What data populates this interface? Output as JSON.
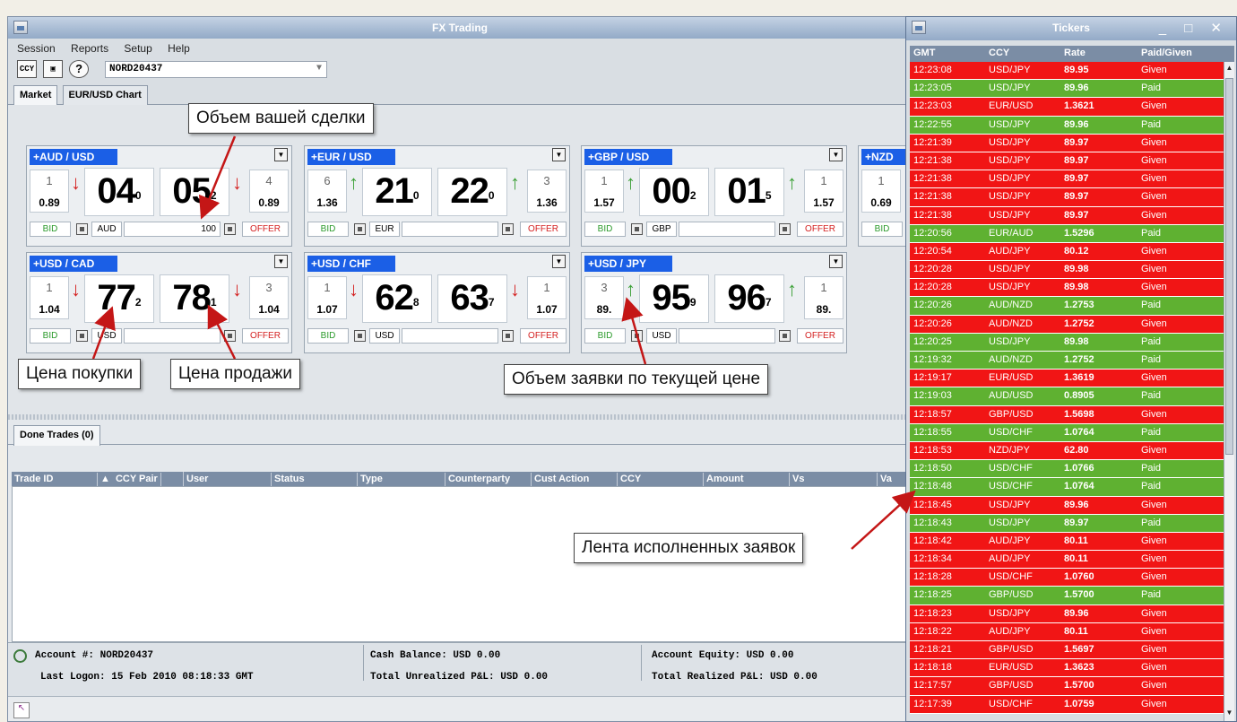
{
  "main_window": {
    "title": "FX Trading",
    "menu": [
      "Session",
      "Reports",
      "Setup",
      "Help"
    ],
    "toolbar": {
      "ccy_icon_text": "CCY",
      "help_icon_text": "?",
      "account_value": "NORD20437"
    },
    "tabs": [
      "Market",
      "EUR/USD Chart"
    ]
  },
  "cards": [
    {
      "pair": "AUD / USD",
      "left_vol": "1",
      "left_rate": "0.89",
      "bid_big": "04",
      "bid_small": "0",
      "ask_big": "05",
      "ask_small": "2",
      "right_vol": "4",
      "right_rate": "0.89",
      "bid_dir": "down",
      "ask_dir": "down",
      "ccy": "AUD",
      "amount": "100"
    },
    {
      "pair": "EUR / USD",
      "left_vol": "6",
      "left_rate": "1.36",
      "bid_big": "21",
      "bid_small": "0",
      "ask_big": "22",
      "ask_small": "0",
      "right_vol": "3",
      "right_rate": "1.36",
      "bid_dir": "up",
      "ask_dir": "up",
      "ccy": "EUR",
      "amount": ""
    },
    {
      "pair": "GBP / USD",
      "left_vol": "1",
      "left_rate": "1.57",
      "bid_big": "00",
      "bid_small": "2",
      "ask_big": "01",
      "ask_small": "5",
      "right_vol": "1",
      "right_rate": "1.57",
      "bid_dir": "up",
      "ask_dir": "up",
      "ccy": "GBP",
      "amount": ""
    },
    {
      "pair": "USD / CAD",
      "left_vol": "1",
      "left_rate": "1.04",
      "bid_big": "77",
      "bid_small": "2",
      "ask_big": "78",
      "ask_small": "1",
      "right_vol": "3",
      "right_rate": "1.04",
      "bid_dir": "down",
      "ask_dir": "down",
      "ccy": "USD",
      "amount": ""
    },
    {
      "pair": "USD / CHF",
      "left_vol": "1",
      "left_rate": "1.07",
      "bid_big": "62",
      "bid_small": "8",
      "ask_big": "63",
      "ask_small": "7",
      "right_vol": "1",
      "right_rate": "1.07",
      "bid_dir": "down",
      "ask_dir": "down",
      "ccy": "USD",
      "amount": ""
    },
    {
      "pair": "USD / JPY",
      "left_vol": "3",
      "left_rate": "89.",
      "bid_big": "95",
      "bid_small": "9",
      "ask_big": "96",
      "ask_small": "7",
      "right_vol": "1",
      "right_rate": "89.",
      "bid_dir": "up",
      "ask_dir": "up",
      "ccy": "USD",
      "amount": ""
    }
  ],
  "nzd_card": {
    "pair": "NZD",
    "left_vol": "1",
    "left_rate": "0.69",
    "bid": "BID"
  },
  "labels": {
    "bid": "BID",
    "offer": "OFFER"
  },
  "done_trades": {
    "tab": "Done Trades (0)",
    "columns": [
      "Trade ID",
      "CCY Pair",
      "User",
      "Status",
      "Type",
      "Counterparty",
      "Cust Action",
      "CCY",
      "Amount",
      "Vs",
      "Va"
    ]
  },
  "status": {
    "account": "Account #:  NORD20437",
    "last_logon": "Last Logon:  15 Feb 2010 08:18:33 GMT",
    "cash_balance": "Cash Balance:  USD 0.00",
    "unrealized": "Total Unrealized P&L:  USD 0.00",
    "equity": "Account Equity:  USD 0.00",
    "realized": "Total Realized P&L:  USD 0.00"
  },
  "tickers": {
    "title": "Tickers",
    "controls": "_ □ ✕",
    "columns": [
      "GMT",
      "CCY",
      "Rate",
      "Paid/Given"
    ],
    "rows": [
      [
        "12:23:08",
        "USD/JPY",
        "89.95",
        "Given"
      ],
      [
        "12:23:05",
        "USD/JPY",
        "89.96",
        "Paid"
      ],
      [
        "12:23:03",
        "EUR/USD",
        "1.3621",
        "Given"
      ],
      [
        "12:22:55",
        "USD/JPY",
        "89.96",
        "Paid"
      ],
      [
        "12:21:39",
        "USD/JPY",
        "89.97",
        "Given"
      ],
      [
        "12:21:38",
        "USD/JPY",
        "89.97",
        "Given"
      ],
      [
        "12:21:38",
        "USD/JPY",
        "89.97",
        "Given"
      ],
      [
        "12:21:38",
        "USD/JPY",
        "89.97",
        "Given"
      ],
      [
        "12:21:38",
        "USD/JPY",
        "89.97",
        "Given"
      ],
      [
        "12:20:56",
        "EUR/AUD",
        "1.5296",
        "Paid"
      ],
      [
        "12:20:54",
        "AUD/JPY",
        "80.12",
        "Given"
      ],
      [
        "12:20:28",
        "USD/JPY",
        "89.98",
        "Given"
      ],
      [
        "12:20:28",
        "USD/JPY",
        "89.98",
        "Given"
      ],
      [
        "12:20:26",
        "AUD/NZD",
        "1.2753",
        "Paid"
      ],
      [
        "12:20:26",
        "AUD/NZD",
        "1.2752",
        "Given"
      ],
      [
        "12:20:25",
        "USD/JPY",
        "89.98",
        "Paid"
      ],
      [
        "12:19:32",
        "AUD/NZD",
        "1.2752",
        "Paid"
      ],
      [
        "12:19:17",
        "EUR/USD",
        "1.3619",
        "Given"
      ],
      [
        "12:19:03",
        "AUD/USD",
        "0.8905",
        "Paid"
      ],
      [
        "12:18:57",
        "GBP/USD",
        "1.5698",
        "Given"
      ],
      [
        "12:18:55",
        "USD/CHF",
        "1.0764",
        "Paid"
      ],
      [
        "12:18:53",
        "NZD/JPY",
        "62.80",
        "Given"
      ],
      [
        "12:18:50",
        "USD/CHF",
        "1.0766",
        "Paid"
      ],
      [
        "12:18:48",
        "USD/CHF",
        "1.0764",
        "Paid"
      ],
      [
        "12:18:45",
        "USD/JPY",
        "89.96",
        "Given"
      ],
      [
        "12:18:43",
        "USD/JPY",
        "89.97",
        "Paid"
      ],
      [
        "12:18:42",
        "AUD/JPY",
        "80.11",
        "Given"
      ],
      [
        "12:18:34",
        "AUD/JPY",
        "80.11",
        "Given"
      ],
      [
        "12:18:28",
        "USD/CHF",
        "1.0760",
        "Given"
      ],
      [
        "12:18:25",
        "GBP/USD",
        "1.5700",
        "Paid"
      ],
      [
        "12:18:23",
        "USD/JPY",
        "89.96",
        "Given"
      ],
      [
        "12:18:22",
        "AUD/JPY",
        "80.11",
        "Given"
      ],
      [
        "12:18:21",
        "GBP/USD",
        "1.5697",
        "Given"
      ],
      [
        "12:18:18",
        "EUR/USD",
        "1.3623",
        "Given"
      ],
      [
        "12:17:57",
        "GBP/USD",
        "1.5700",
        "Given"
      ],
      [
        "12:17:39",
        "USD/CHF",
        "1.0759",
        "Given"
      ]
    ]
  },
  "callouts": {
    "deal_volume": "Объем вашей сделки",
    "buy_price": "Цена покупки",
    "sell_price": "Цена продажи",
    "order_volume": "Объем заявки по текущей цене",
    "feed": "Лента исполненных заявок"
  },
  "colors": {
    "given": "#f11515",
    "paid": "#5fb131",
    "pair_label": "#1b5fe6",
    "arrow_callout": "#c41616"
  }
}
